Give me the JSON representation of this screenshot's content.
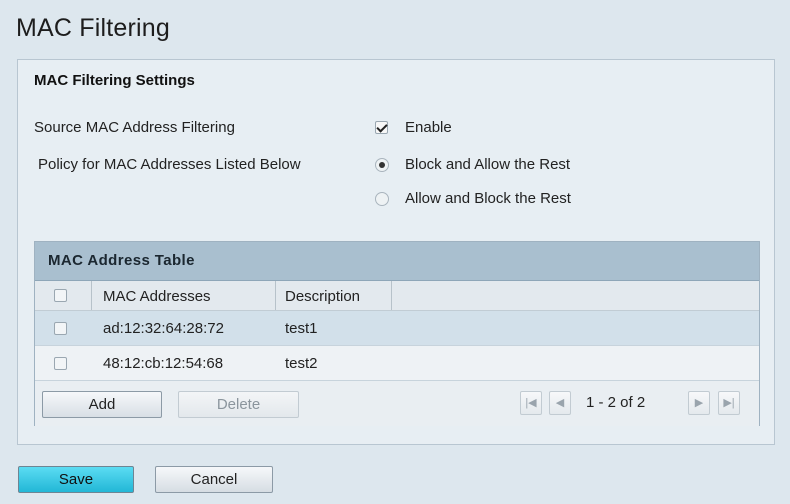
{
  "page": {
    "title": "MAC Filtering"
  },
  "settings": {
    "heading": "MAC Filtering Settings",
    "source_filter_label": "Source MAC Address Filtering",
    "enable_label": "Enable",
    "enable_checked": true,
    "policy_label": "Policy for MAC Addresses Listed Below",
    "policy_options": [
      {
        "label": "Block and Allow the Rest",
        "selected": true
      },
      {
        "label": "Allow and Block the Rest",
        "selected": false
      }
    ]
  },
  "table": {
    "title": "MAC Address Table",
    "columns": [
      "MAC Addresses",
      "Description"
    ],
    "rows": [
      {
        "mac": "ad:12:32:64:28:72",
        "description": "test1"
      },
      {
        "mac": "48:12:cb:12:54:68",
        "description": "test2"
      }
    ],
    "add_label": "Add",
    "delete_label": "Delete",
    "pager": {
      "info": "1 - 2 of 2",
      "first_icon": "|◀",
      "prev_icon": "◀",
      "next_icon": "▶",
      "last_icon": "▶|"
    }
  },
  "actions": {
    "save_label": "Save",
    "cancel_label": "Cancel"
  },
  "colors": {
    "save_button": "#22b7d6",
    "table_header": "#a9bfcf",
    "row_highlight": "#d2e0ea"
  }
}
